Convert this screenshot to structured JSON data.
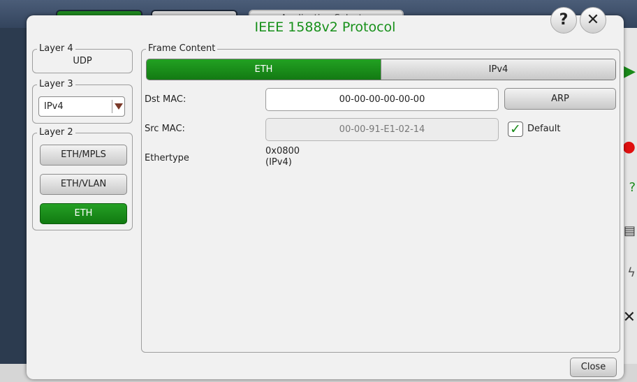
{
  "background": {
    "tab_title": "Application Selector"
  },
  "dialog": {
    "title": "IEEE 1588v2 Protocol",
    "help_glyph": "?",
    "close_glyph": "✕",
    "close_label": "Close"
  },
  "layer4": {
    "legend": "Layer 4",
    "value": "UDP"
  },
  "layer3": {
    "legend": "Layer 3",
    "selected": "IPv4"
  },
  "layer2": {
    "legend": "Layer 2",
    "buttons": [
      "ETH/MPLS",
      "ETH/VLAN",
      "ETH"
    ],
    "active": "ETH"
  },
  "frame": {
    "legend": "Frame Content",
    "tabs": [
      "ETH",
      "IPv4"
    ],
    "active_tab": "ETH",
    "dst_mac_label": "Dst MAC:",
    "dst_mac_value": "00-00-00-00-00-00",
    "arp_label": "ARP",
    "src_mac_label": "Src MAC:",
    "src_mac_value": "00-00-91-E1-02-14",
    "default_label": "Default",
    "default_checked": true,
    "ethertype_label": "Ethertype",
    "ethertype_value": "0x0800",
    "ethertype_note": "(IPv4)"
  },
  "icons": {
    "help": "help-icon",
    "close": "close-icon",
    "dropdown": "chevron-down-icon",
    "check": "checkmark-icon"
  },
  "colors": {
    "accent_green": "#17901a",
    "active_button": "#1a8f1a"
  }
}
